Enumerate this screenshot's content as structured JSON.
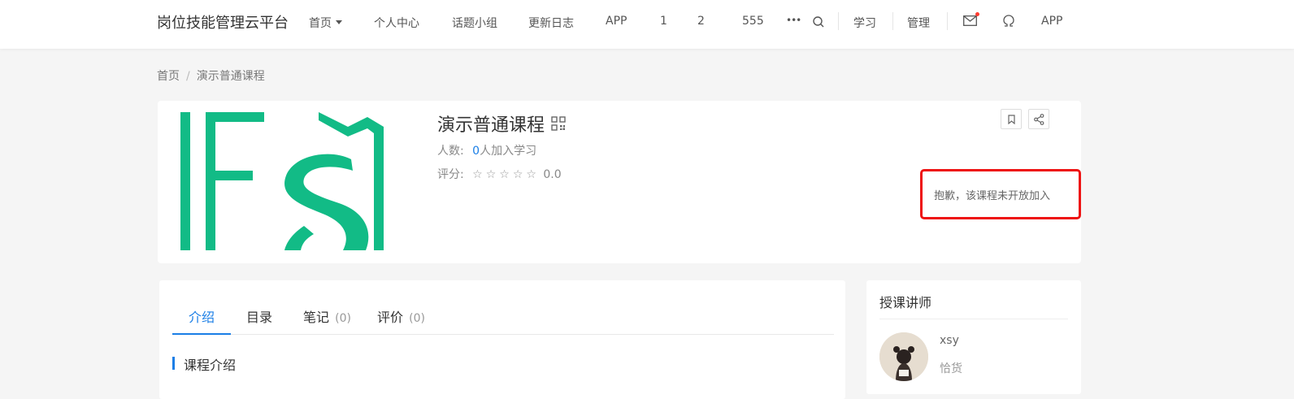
{
  "header": {
    "brand": "岗位技能管理云平台",
    "nav": [
      {
        "label": "首页",
        "dropdown": true
      },
      {
        "label": "个人中心"
      },
      {
        "label": "话题小组"
      },
      {
        "label": "更新日志"
      },
      {
        "label": "APP"
      },
      {
        "label": "1"
      },
      {
        "label": "2"
      },
      {
        "label": "555"
      }
    ],
    "more_label": "•••",
    "study_label": "学习",
    "manage_label": "管理",
    "app_label": "APP",
    "icons": [
      "search-icon",
      "mail-icon",
      "omega-icon"
    ],
    "notification_dot_color": "#ff3b30"
  },
  "breadcrumb": {
    "home": "首页",
    "separator": "/",
    "current": "演示普通课程"
  },
  "course": {
    "title": "演示普通课程",
    "members_label": "人数:",
    "members_count": "0",
    "members_suffix": "人加入学习",
    "rating_label": "评分:",
    "stars": "☆☆☆☆☆",
    "score": "0.0",
    "notice": "抱歉，该课程未开放加入",
    "icons": [
      "qrcode-icon",
      "bookmark-icon",
      "share-icon"
    ],
    "logo_color": "#12bb86"
  },
  "tabs": [
    {
      "label": "介绍",
      "count": "",
      "active": true
    },
    {
      "label": "目录",
      "count": "",
      "active": false
    },
    {
      "label": "笔记",
      "count": "(0)",
      "active": false
    },
    {
      "label": "评价",
      "count": "(0)",
      "active": false
    }
  ],
  "intro": {
    "section_title": "课程介绍"
  },
  "teacher_panel": {
    "title": "授课讲师",
    "name": "xsy",
    "role": "恰货"
  },
  "colors": {
    "accent": "#1a7ee6",
    "notice_border": "#ee1111"
  }
}
